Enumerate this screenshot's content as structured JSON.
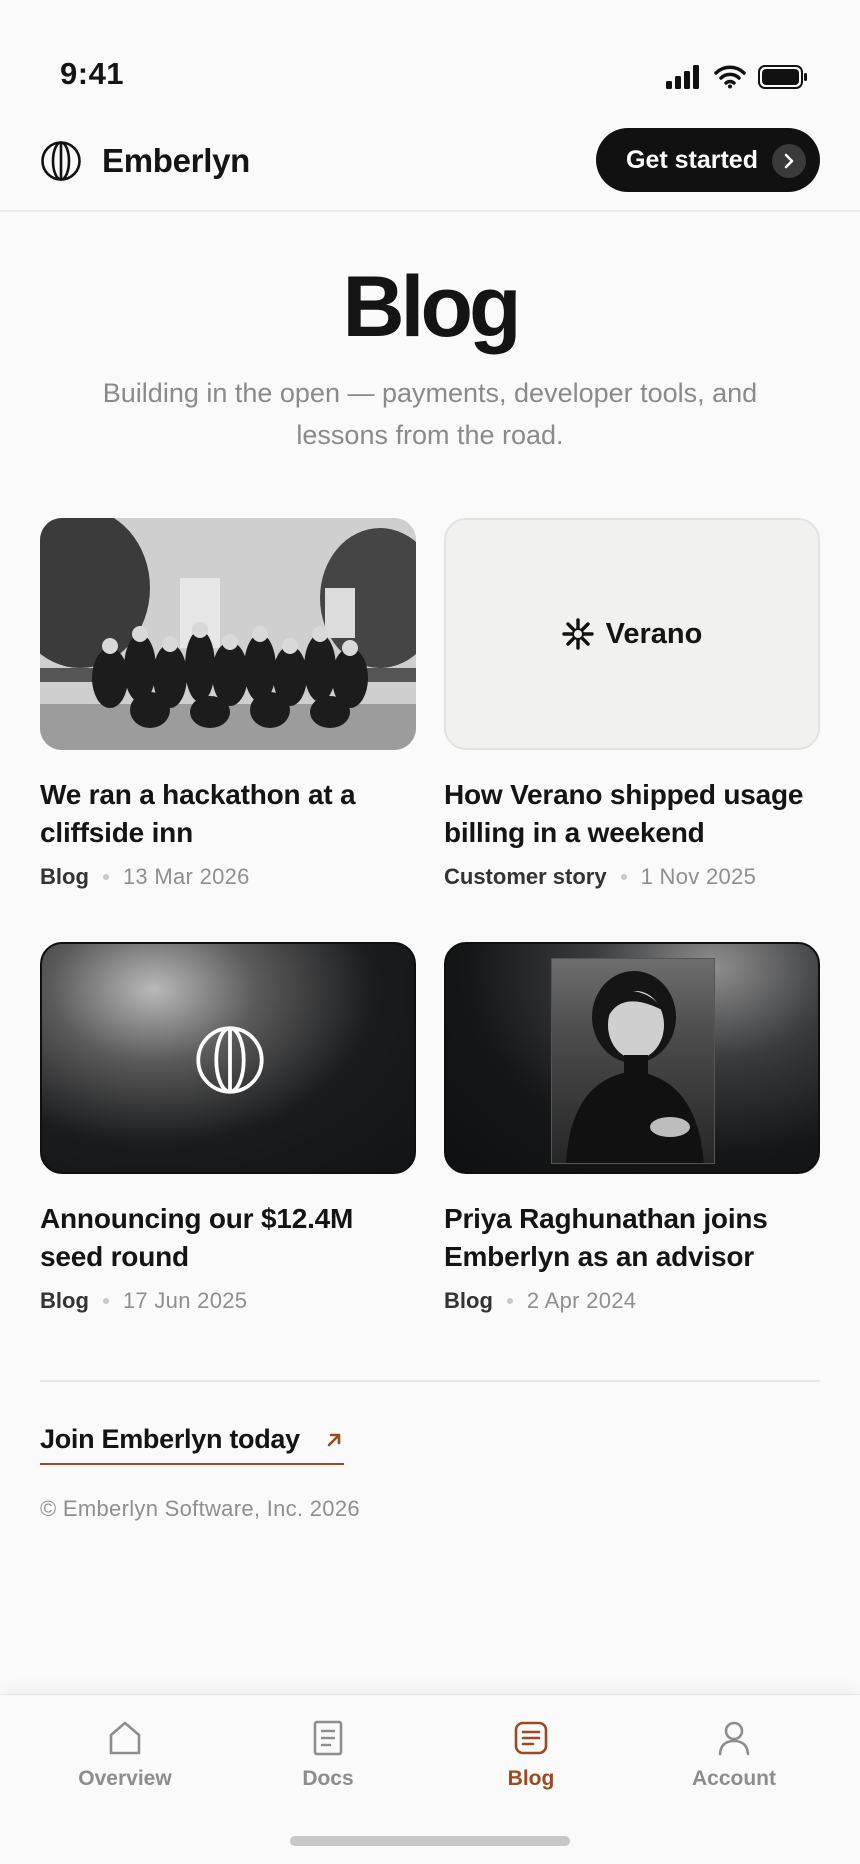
{
  "status_bar": {
    "time": "9:41"
  },
  "header": {
    "brand": "Emberlyn",
    "cta_label": "Get started"
  },
  "hero": {
    "title": "Blog",
    "subtitle": "Building in the open — payments, developer tools, and lessons from the road."
  },
  "posts": [
    {
      "title": "We ran a hackathon at a cliffside inn",
      "category": "Blog",
      "date": "13 Mar 2026"
    },
    {
      "title": "How Verano shipped usage billing in a weekend",
      "category": "Customer story",
      "date": "1 Nov 2025",
      "logo_text": "Verano"
    },
    {
      "title": "Announcing our $12.4M seed round",
      "category": "Blog",
      "date": "17 Jun 2025"
    },
    {
      "title": "Priya Raghunathan joins Emberlyn as an advisor",
      "category": "Blog",
      "date": "2 Apr 2024"
    }
  ],
  "footer": {
    "join_label": "Join Emberlyn today",
    "copyright": "© Emberlyn Software, Inc. 2026"
  },
  "tabs": [
    {
      "label": "Overview",
      "icon": "home-icon",
      "active": false
    },
    {
      "label": "Docs",
      "icon": "document-icon",
      "active": false
    },
    {
      "label": "Blog",
      "icon": "blog-icon",
      "active": true
    },
    {
      "label": "Account",
      "icon": "user-icon",
      "active": false
    }
  ],
  "colors": {
    "accent": "#9b4a22",
    "text": "#141414",
    "muted": "#8f8f8f",
    "background": "#fafafa"
  }
}
